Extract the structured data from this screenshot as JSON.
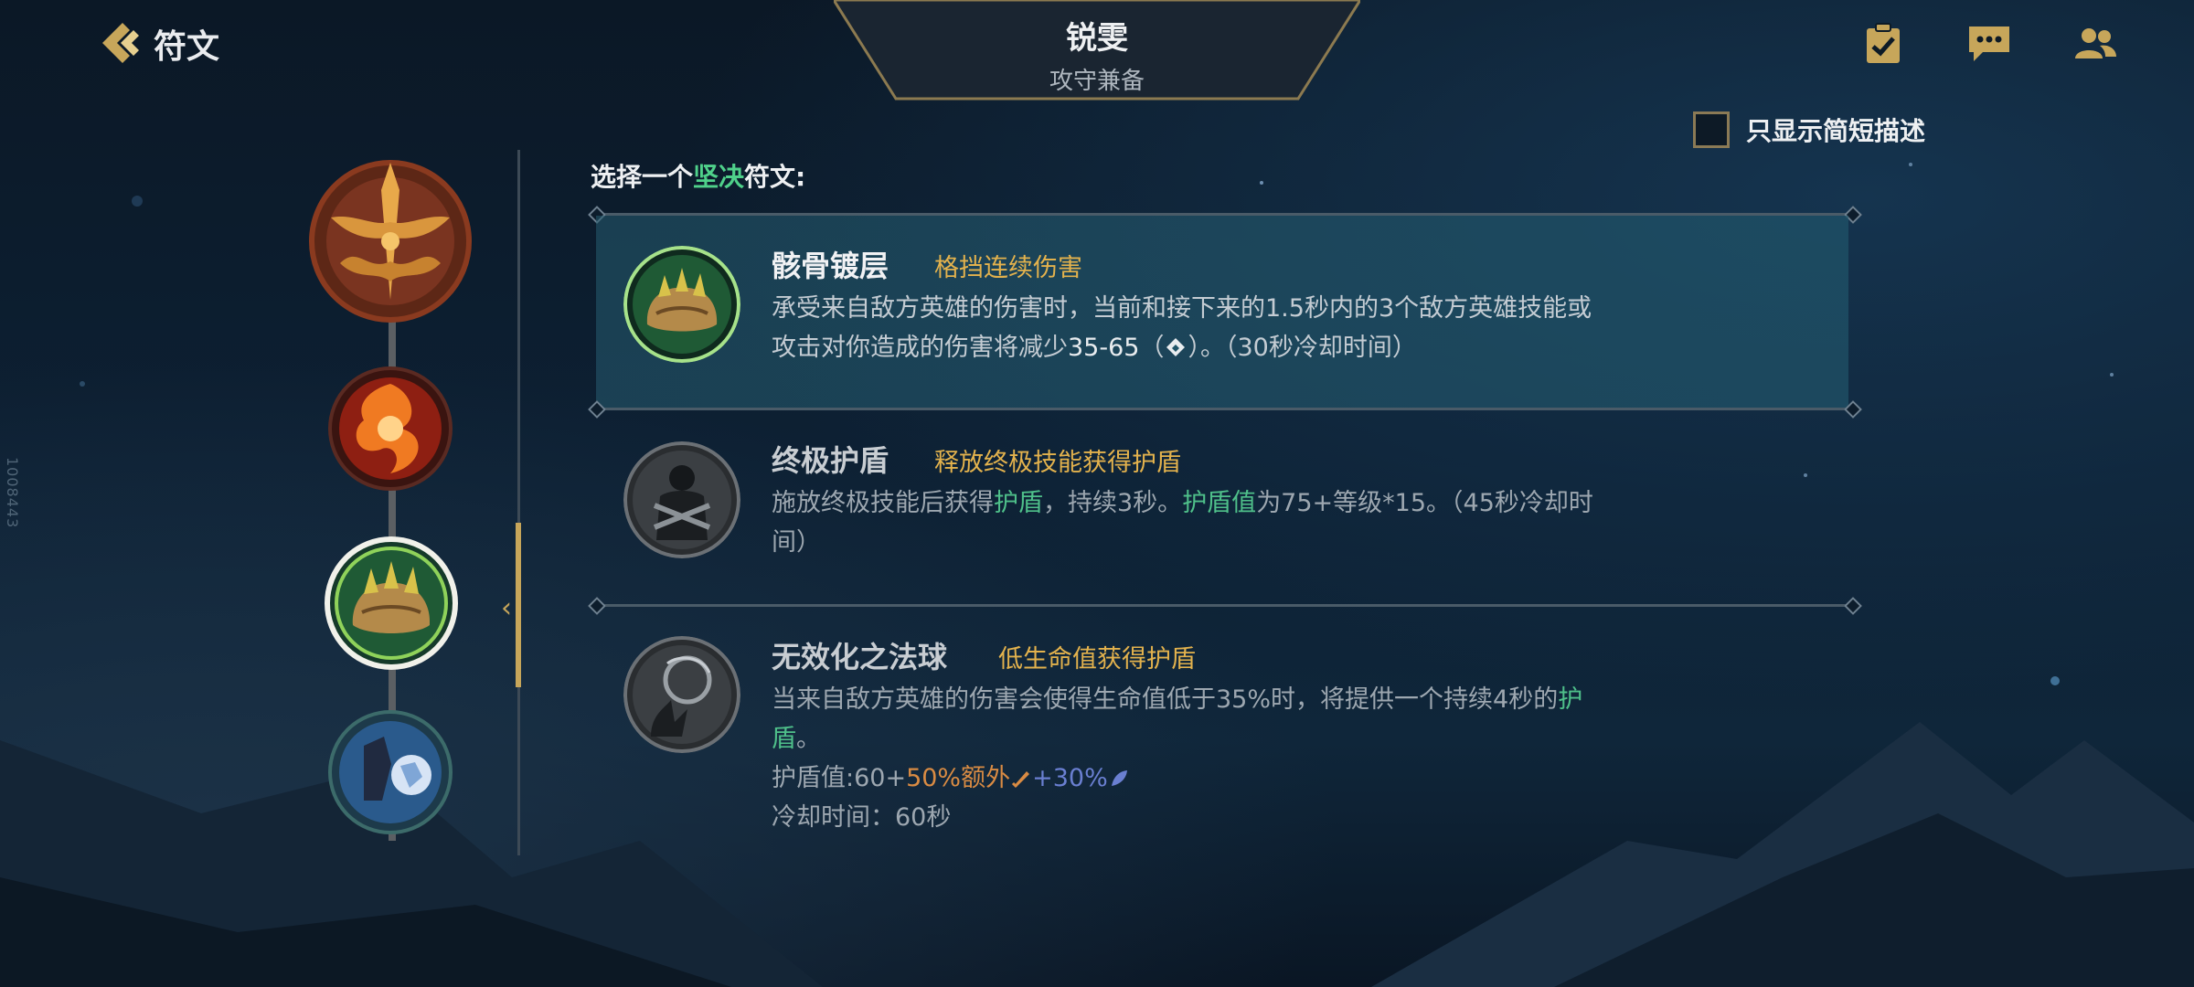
{
  "header": {
    "page_title": "符文",
    "champion_name": "锐雯",
    "champion_role": "攻守兼备"
  },
  "top_icons": [
    "checklist-icon",
    "chat-icon",
    "friends-icon"
  ],
  "short_desc_toggle": {
    "label": "只显示简短描述",
    "checked": false
  },
  "side_id": "1008443",
  "prompt": {
    "prefix": "选择一个",
    "highlight": "坚决",
    "suffix": "符文:"
  },
  "runes": [
    {
      "name": "骸骨镀层",
      "tag": "格挡连续伤害",
      "selected": true,
      "desc_1": "承受来自敌方英雄的伤害时，当前和接下来的1.5秒内的3个敌方英雄技能或",
      "desc_2a": "攻击对你造成的伤害将减少",
      "desc_2b": "35-65",
      "desc_2c": "（",
      "desc_2d": "）。（30秒冷却时间）"
    },
    {
      "name": "终极护盾",
      "tag": "释放终极技能获得护盾",
      "selected": false,
      "d1": "施放终极技能后获得",
      "d2": "护盾",
      "d3": "，持续3秒。",
      "d4": "护盾值",
      "d5": "为75+等级*15。（45秒冷却时",
      "d6": "间）"
    },
    {
      "name": "无效化之法球",
      "tag": "低生命值获得护盾",
      "selected": false,
      "d1": "当来自敌方英雄的伤害会使得生命值低于35%时，将提供一个持续4秒的",
      "d2": "护",
      "d3": "盾",
      "d4": "。",
      "shield_a": "护盾值:60+",
      "shield_b": "50%额外",
      "shield_c": "+30%",
      "cooldown": "冷却时间：60秒"
    }
  ],
  "colors": {
    "gold": "#c7a65a",
    "tag": "#e3b24d",
    "green": "#4fc08a",
    "selected_bg": "#1f5468"
  }
}
